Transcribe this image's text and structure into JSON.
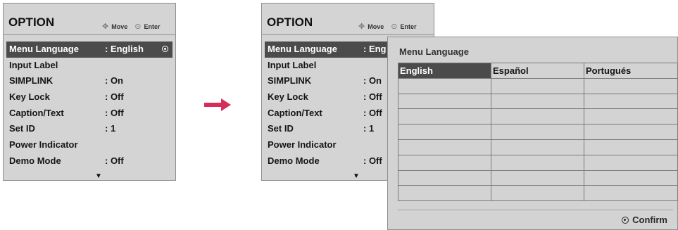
{
  "left_panel": {
    "title": "OPTION",
    "hint_move": "Move",
    "hint_enter": "Enter",
    "items": [
      {
        "label": "Menu Language",
        "value": ": English"
      },
      {
        "label": "Input Label",
        "value": ""
      },
      {
        "label": "SIMPLINK",
        "value": ": On"
      },
      {
        "label": "Key Lock",
        "value": ": Off"
      },
      {
        "label": "Caption/Text",
        "value": ": Off"
      },
      {
        "label": "Set ID",
        "value": ": 1"
      },
      {
        "label": "Power Indicator",
        "value": ""
      },
      {
        "label": "Demo Mode",
        "value": ": Off"
      }
    ]
  },
  "right_panel": {
    "title": "OPTION",
    "hint_move": "Move",
    "hint_enter": "Enter",
    "items": [
      {
        "label": "Menu Language",
        "value": ": Eng"
      },
      {
        "label": "Input Label",
        "value": ""
      },
      {
        "label": "SIMPLINK",
        "value": ": On"
      },
      {
        "label": "Key Lock",
        "value": ": Off"
      },
      {
        "label": "Caption/Text",
        "value": ": Off"
      },
      {
        "label": "Set ID",
        "value": ": 1"
      },
      {
        "label": "Power Indicator",
        "value": ""
      },
      {
        "label": "Demo Mode",
        "value": ": Off"
      }
    ]
  },
  "popup": {
    "title": "Menu Language",
    "languages": [
      "English",
      "Español",
      "Portugués"
    ],
    "empty_rows": 8,
    "confirm_label": "Confirm"
  },
  "colors": {
    "panel_bg": "#d4d4d4",
    "selected_bg": "#4b4b4b",
    "arrow": "#d62e5a"
  },
  "icons": {
    "move": "dpad-arrows-icon",
    "enter": "enter-circle-icon",
    "scroll_down": "down-triangle-icon",
    "confirm": "confirm-circle-icon",
    "transition": "right-arrow-icon"
  }
}
